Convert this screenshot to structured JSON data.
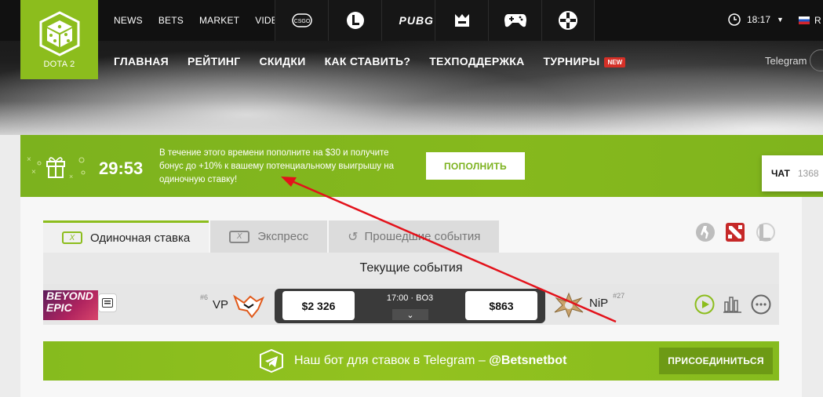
{
  "header": {
    "logo_label": "DOTA 2",
    "top_nav": [
      "NEWS",
      "BETS",
      "MARKET",
      "VIDEO"
    ],
    "game_tabs": [
      "csgo-icon",
      "lol-icon",
      "pubg-icon",
      "crown-icon",
      "gamepad-icon",
      "tf-icon"
    ],
    "pubg_label": "PUBG",
    "csgo_label": "CSGO",
    "time": "18:17",
    "lang": "R",
    "main_nav": [
      "ГЛАВНАЯ",
      "РЕЙТИНГ",
      "СКИДКИ",
      "КАК СТАВИТЬ?",
      "ТЕХПОДДЕРЖКА",
      "ТУРНИРЫ"
    ],
    "new_badge": "NEW",
    "telegram": "Telegram"
  },
  "promo": {
    "timer": "29:53",
    "text": "В течение этого времени пополните на $30 и получите бонус до +10% к вашему потенциальному выигрышу на одиночную ставку!",
    "button": "ПОПОЛНИТЬ"
  },
  "chat": {
    "label": "ЧАТ",
    "count": "1368"
  },
  "tabs": [
    "Одиночная ставка",
    "Экспресс",
    "Прошедшие события"
  ],
  "events_header": "Текущие события",
  "match": {
    "tournament": "BEYOND EPIC",
    "team1": {
      "name": "VP",
      "rank": "#6",
      "odds": "$2 326"
    },
    "team2": {
      "name": "NiP",
      "rank": "#27",
      "odds": "$863"
    },
    "time": "17:00 · BO3"
  },
  "telegram_banner": {
    "text": "Наш бот для ставок в Telegram – ",
    "handle": "@Betsnetbot",
    "button": "ПРИСОЕДИНИТЬСЯ"
  },
  "colors": {
    "accent": "#8cbd1d",
    "arrow": "#e3121b",
    "dark": "#111111"
  }
}
